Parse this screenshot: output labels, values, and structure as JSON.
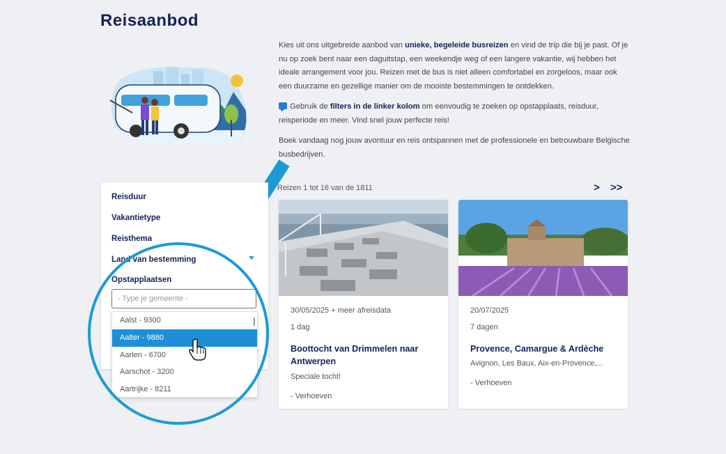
{
  "page": {
    "title": "Reisaanbod"
  },
  "intro": {
    "p1_a": "Kies uit ons uitgebreide aanbod van ",
    "p1_b": "unieke, begeleide busreizen",
    "p1_c": " en vind de trip die bij je past. Of je nu op zoek bent naar een daguitstap, een weekendje weg of een langere vakantie, wij hebben het ideale arrangement voor jou. Reizen met de bus is niet alleen comfortabel en zorgeloos, maar ook een duurzame en gezellige manier om de mooiste bestemmingen te ontdekken.",
    "p2_a": "Gebruik de ",
    "p2_b": "filters in de linker kolom",
    "p2_c": " om eenvoudig te zoeken op opstapplaats, reisduur, reisperiode en meer. Vind snel jouw perfecte reis!",
    "p3": "Boek vandaag nog jouw avontuur en reis ontspannen met de professionele en betrouwbare Belgische busbedrijven.",
    "icon": "chat-icon"
  },
  "filters": {
    "reisduur": "Reisduur",
    "vakantietype": "Vakantietype",
    "reisthema": "Reisthema",
    "land": "Land van bestemming",
    "opstapplaatsen": "Opstapplaatsen",
    "search_placeholder": "- Type je gemeente -",
    "options": [
      "Aalst - 9300",
      "Aalter - 9880",
      "Aarlen - 6700",
      "Aarschot - 3200",
      "Aartrijke - 8211"
    ],
    "selected_option": "Aalter - 9880"
  },
  "results": {
    "count": "Reizen 1 tot 16 van de 1811",
    "next": ">",
    "last": ">>"
  },
  "cards": [
    {
      "date": "30/05/2025 + meer afreisdata",
      "duration": "1 dag",
      "title": "Boottocht van Drimmelen naar Antwerpen",
      "subtitle": "Speciale tocht!",
      "operator": "- Verhoeven"
    },
    {
      "date": "20/07/2025",
      "duration": "7 dagen",
      "title": "Provence, Camargue & Ardèche",
      "subtitle": "Avignon, Les Baux, Aix-en-Provence,...",
      "operator": "- Verhoeven"
    }
  ],
  "colors": {
    "brand": "#162257",
    "accent": "#1d9ad6",
    "selected": "#1d8fd8"
  }
}
